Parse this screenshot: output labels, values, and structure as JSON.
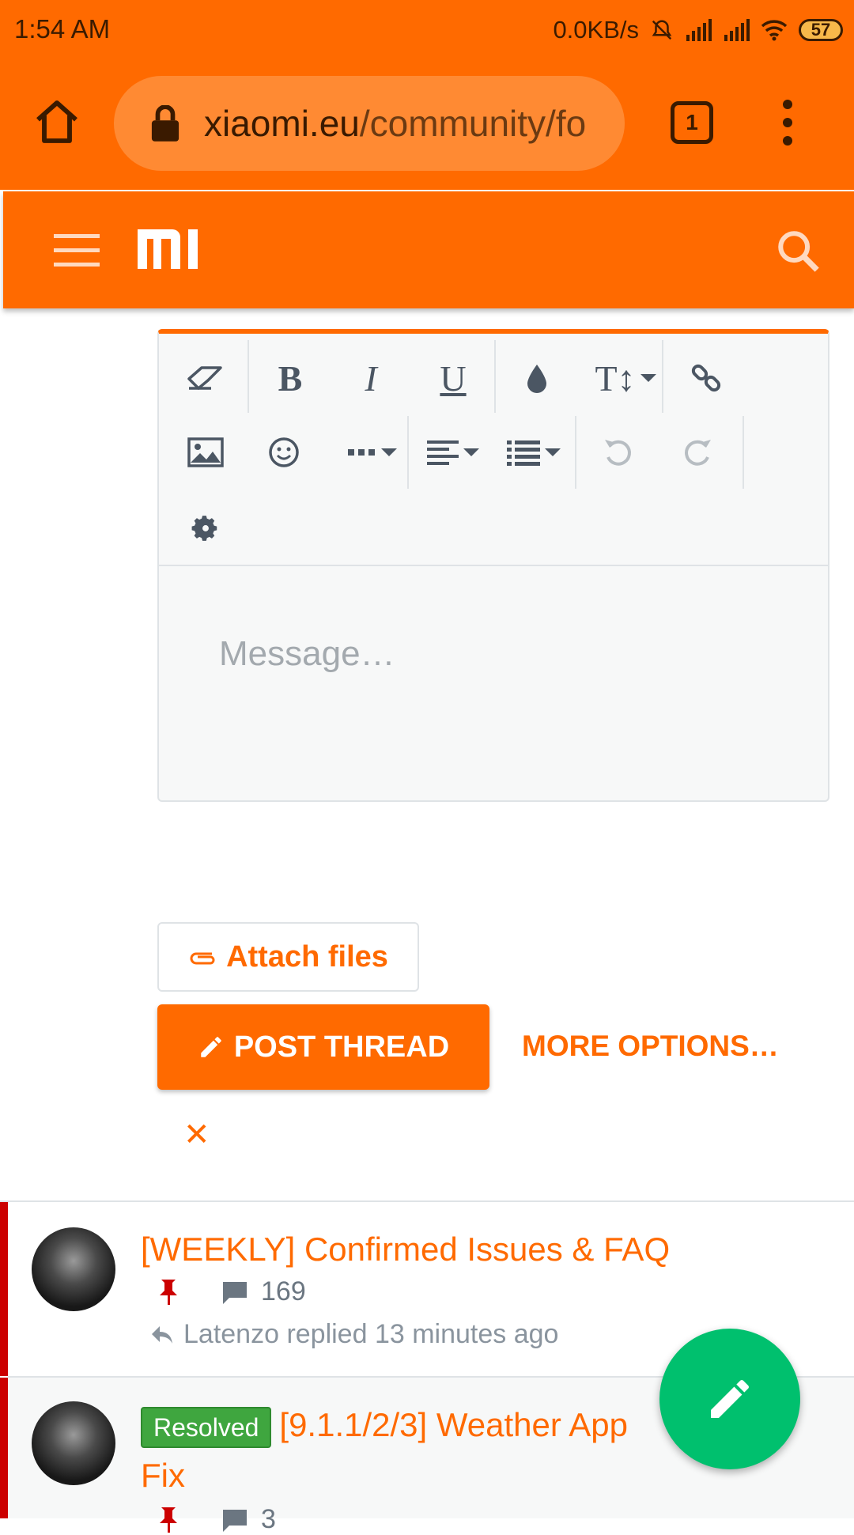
{
  "status_bar": {
    "time": "1:54 AM",
    "net_speed": "0.0KB/s",
    "battery": "57"
  },
  "browser": {
    "url_host": "xiaomi.eu",
    "url_path": "/community/fo",
    "tab_count": "1"
  },
  "editor": {
    "placeholder": "Message…",
    "toolbar": {
      "row1": [
        "eraser-icon",
        "bold-icon",
        "italic-icon",
        "underline-icon",
        "color-drop-icon",
        "font-size-icon",
        "link-icon"
      ],
      "row2": [
        "image-icon",
        "smiley-icon",
        "more-icon",
        "align-icon",
        "list-icon",
        "undo-icon",
        "redo-icon"
      ],
      "row3": [
        "gear-icon"
      ],
      "bold_label": "B",
      "italic_label": "I",
      "underline_label": "U",
      "font_size_label": "T↕"
    }
  },
  "actions": {
    "attach_label": "Attach files",
    "post_label": "POST THREAD",
    "more_options_label": "MORE OPTIONS…",
    "cancel_label": "✕"
  },
  "threads": [
    {
      "title": "[WEEKLY] Confirmed Issues & FAQ",
      "sticky": true,
      "reply_count": "169",
      "latest": "Latenzo replied 13 minutes ago"
    },
    {
      "prefix": "Resolved",
      "title_line1": "[9.1.1/2/3] Weather App",
      "title_line2": "Fix",
      "sticky": true,
      "reply_count": "3"
    }
  ],
  "colors": {
    "brand": "#ff6a00",
    "sticky_bar": "#cc0000",
    "fab": "#00c06e",
    "resolved": "#3fa63f"
  }
}
